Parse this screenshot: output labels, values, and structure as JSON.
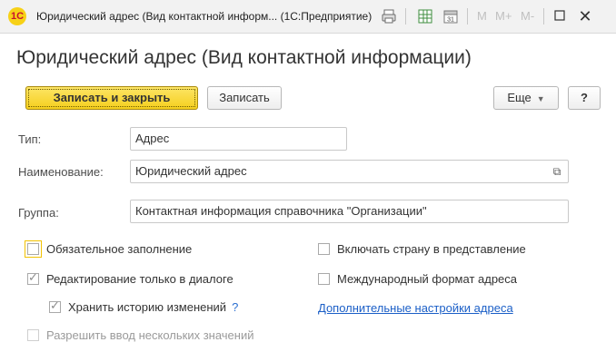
{
  "window": {
    "title": "Юридический адрес (Вид контактной информ...  (1С:Предприятие)",
    "logo_text": "1С",
    "icons": [
      "print-icon",
      "table-icon",
      "calendar-icon"
    ],
    "memory_buttons": [
      "M",
      "M+",
      "M-"
    ],
    "calendar_day": "31"
  },
  "header": {
    "title": "Юридический адрес (Вид контактной информации)"
  },
  "toolbar": {
    "save_close_label": "Записать и закрыть",
    "save_label": "Записать",
    "more_label": "Еще",
    "help_label": "?"
  },
  "form": {
    "type_label": "Тип:",
    "type_value": "Адрес",
    "name_label": "Наименование:",
    "name_value": "Юридический адрес",
    "group_label": "Группа:",
    "group_value": "Контактная информация справочника \"Организации\""
  },
  "options": {
    "mandatory": "Обязательное заполнение",
    "dialog_only": "Редактирование только в диалоге",
    "history": "Хранить историю изменений",
    "history_help": "?",
    "multiple": "Разрешить ввод нескольких значений",
    "include_country": "Включать страну в представление",
    "intl_format": "Международный формат адреса",
    "extra_settings_link": "Дополнительные настройки адреса"
  },
  "colors": {
    "primary_button": "#f5cf1d",
    "link": "#1b5fc7",
    "focus": "#f2c200"
  }
}
